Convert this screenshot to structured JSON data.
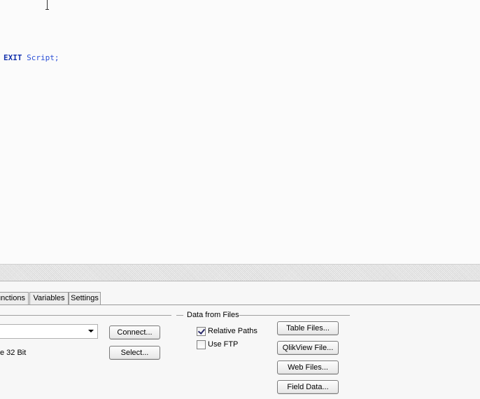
{
  "editor": {
    "keyword": "EXIT",
    "statement": " Script;"
  },
  "tabs": [
    {
      "label": "unctions"
    },
    {
      "label": "Variables"
    },
    {
      "label": "Settings"
    }
  ],
  "database": {
    "selected_value": "",
    "provider_label": "e 32 Bit",
    "connect_label": "Connect...",
    "select_label": "Select..."
  },
  "data_from_files": {
    "title": "Data from Files",
    "relative_paths_label": "Relative Paths",
    "relative_paths_checked": true,
    "use_ftp_label": "Use FTP",
    "use_ftp_checked": false,
    "buttons": {
      "table_files": "Table Files...",
      "qlikview_file": "QlikView File...",
      "web_files": "Web Files...",
      "field_data": "Field Data..."
    }
  }
}
